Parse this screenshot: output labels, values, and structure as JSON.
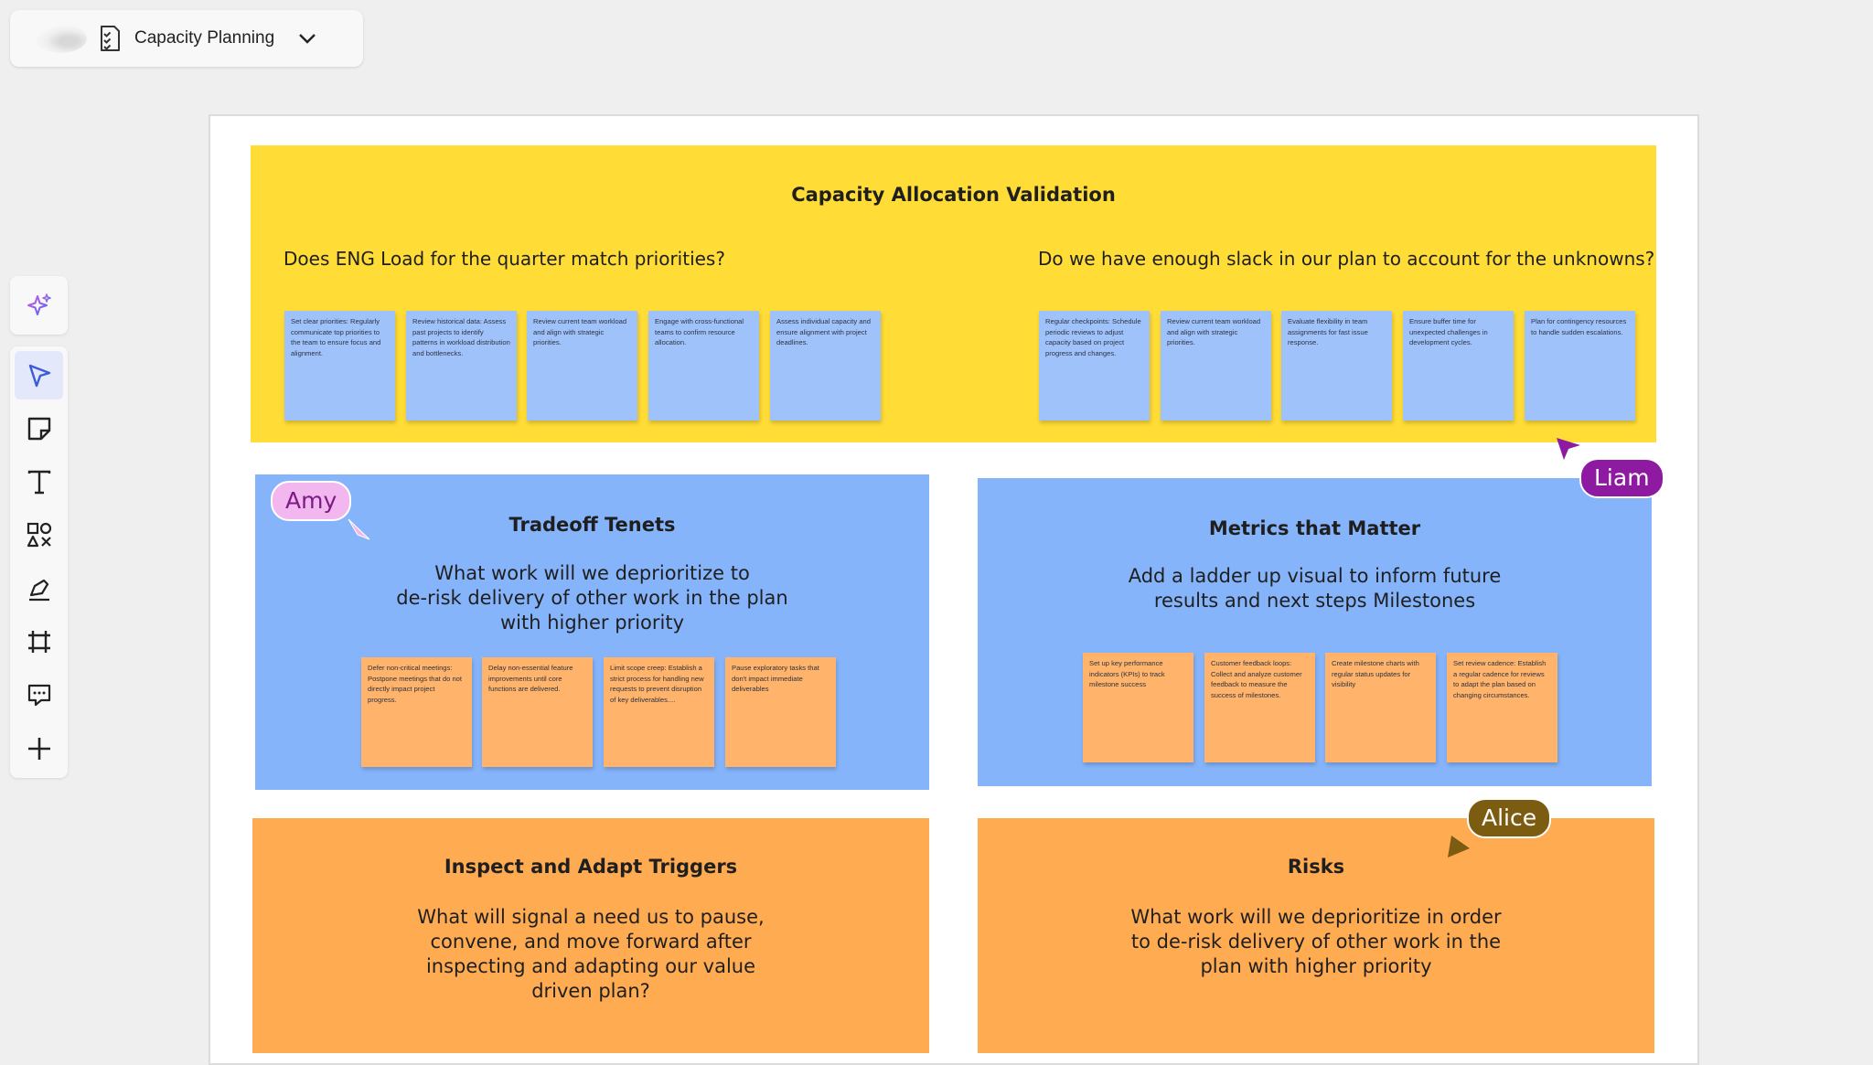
{
  "board": {
    "title": "Capacity Planning"
  },
  "toolbar": {
    "ai": "sparkle-icon",
    "tools": [
      "select",
      "sticky-note",
      "text",
      "shapes",
      "pen",
      "frame",
      "comment",
      "add"
    ]
  },
  "sections": {
    "capacity": {
      "title": "Capacity Allocation Validation",
      "q1": "Does ENG Load for the quarter match priorities?",
      "q2": "Do we have enough slack in our plan to account for the unknowns?",
      "notes_left": [
        "Set clear priorities: Regularly communicate top priorities to the team to ensure focus and alignment.",
        "Review historical data: Assess past projects to identify patterns in workload distribution and bottlenecks.",
        "Review current team workload and align with strategic priorities.",
        "Engage with cross-functional teams to confirm resource allocation.",
        "Assess individual capacity and ensure alignment with project deadlines."
      ],
      "notes_right": [
        "Regular checkpoints: Schedule periodic reviews to adjust capacity based on project progress and changes.",
        "Review current team workload and align with strategic priorities.",
        "Evaluate flexibility in team assignments for fast issue response.",
        "Ensure buffer time for unexpected challenges in development cycles.",
        "Plan for contingency resources to handle sudden escalations."
      ]
    },
    "tradeoff": {
      "title": "Tradeoff Tenets",
      "desc": [
        "What work will we deprioritize to",
        "de-risk delivery of other work in the plan",
        "with higher priority"
      ],
      "notes": [
        "Defer non-critical meetings: Postpone meetings that do not directly impact project progress.",
        "Delay non-essential feature improvements until core functions are delivered.",
        "Limit scope creep: Establish a strict process for handling new requests to prevent disruption of key deliverables....",
        "Pause exploratory tasks that don't impact immediate deliverables"
      ]
    },
    "metrics": {
      "title": "Metrics that Matter",
      "desc": [
        "Add a ladder up visual to inform future",
        "results and next steps Milestones"
      ],
      "notes": [
        "Set up key performance indicators (KPIs) to track milestone success",
        "Customer feedback loops: Collect and analyze customer feedback to measure the success of milestones.",
        "Create milestone charts with regular status updates for visibility",
        "Set review cadence: Establish a regular cadence for reviews to adapt the plan based on changing circumstances."
      ]
    },
    "inspect": {
      "title": "Inspect and Adapt Triggers",
      "desc": [
        "What will signal a need us to pause,",
        "convene, and move forward after",
        "inspecting and adapting our value",
        "driven plan?"
      ]
    },
    "risks": {
      "title": "Risks",
      "desc": [
        "What work will we deprioritize in order",
        "to de-risk delivery of other work in the",
        "plan with higher priority"
      ]
    }
  },
  "cursors": [
    {
      "name": "Amy",
      "color": "#f3b7ef",
      "text_color": "#7a1b86"
    },
    {
      "name": "Liam",
      "color": "#8d1aa0",
      "text_color": "#ffffff"
    },
    {
      "name": "Alice",
      "color": "#7c5c10",
      "text_color": "#ffffff"
    }
  ]
}
